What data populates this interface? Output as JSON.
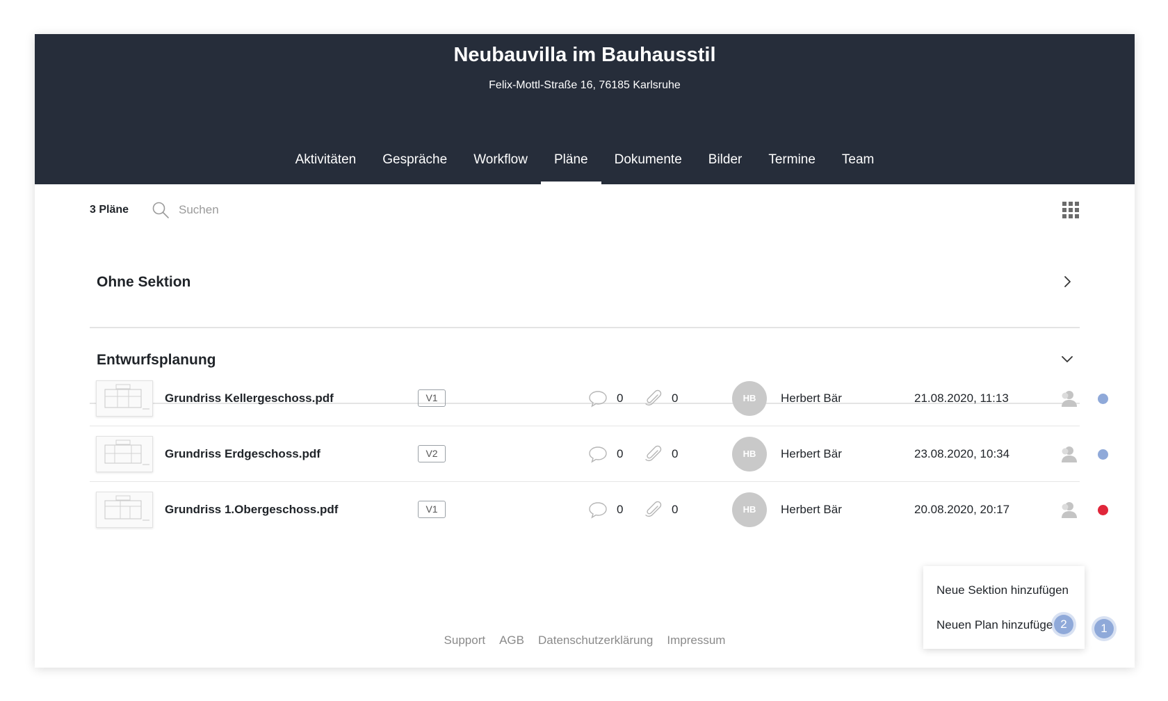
{
  "project": {
    "title": "Neubauvilla im Bauhausstil",
    "address": "Felix-Mottl-Straße 16, 76185 Karlsruhe"
  },
  "tabs": [
    {
      "label": "Aktivitäten"
    },
    {
      "label": "Gespräche"
    },
    {
      "label": "Workflow"
    },
    {
      "label": "Pläne",
      "active": true
    },
    {
      "label": "Dokumente"
    },
    {
      "label": "Bilder"
    },
    {
      "label": "Termine"
    },
    {
      "label": "Team"
    }
  ],
  "toolbar": {
    "count_label": "3 Pläne",
    "search_placeholder": "Suchen",
    "search_icon": "search-icon",
    "view_icon": "grid-view-icon"
  },
  "sections": [
    {
      "title": "Ohne Sektion",
      "state": "collapsed"
    },
    {
      "title": "Entwurfsplanung",
      "state": "expanded"
    }
  ],
  "plans": [
    {
      "name": "Grundriss Kellergeschoss.pdf",
      "version": "V1",
      "comments": "0",
      "attachments": "0",
      "initials": "HB",
      "author": "Herbert Bär",
      "date": "21.08.2020, 11:13",
      "status_color": "#8fa9d9"
    },
    {
      "name": "Grundriss Erdgeschoss.pdf",
      "version": "V2",
      "comments": "0",
      "attachments": "0",
      "initials": "HB",
      "author": "Herbert Bär",
      "date": "23.08.2020, 10:34",
      "status_color": "#8fa9d9"
    },
    {
      "name": "Grundriss 1.Obergeschoss.pdf",
      "version": "V1",
      "comments": "0",
      "attachments": "0",
      "initials": "HB",
      "author": "Herbert Bär",
      "date": "20.08.2020, 20:17",
      "status_color": "#e0263a"
    }
  ],
  "popup": {
    "add_section": "Neue Sektion hinzufügen",
    "add_plan": "Neuen Plan hinzufüge",
    "step_2": "2",
    "step_1": "1"
  },
  "footer": {
    "links": [
      "Support",
      "AGB",
      "Datenschutzerklärung",
      "Impressum"
    ]
  },
  "colors": {
    "header_bg": "#262d3a",
    "accent": "#8fa9d9",
    "status_red": "#e0263a"
  }
}
